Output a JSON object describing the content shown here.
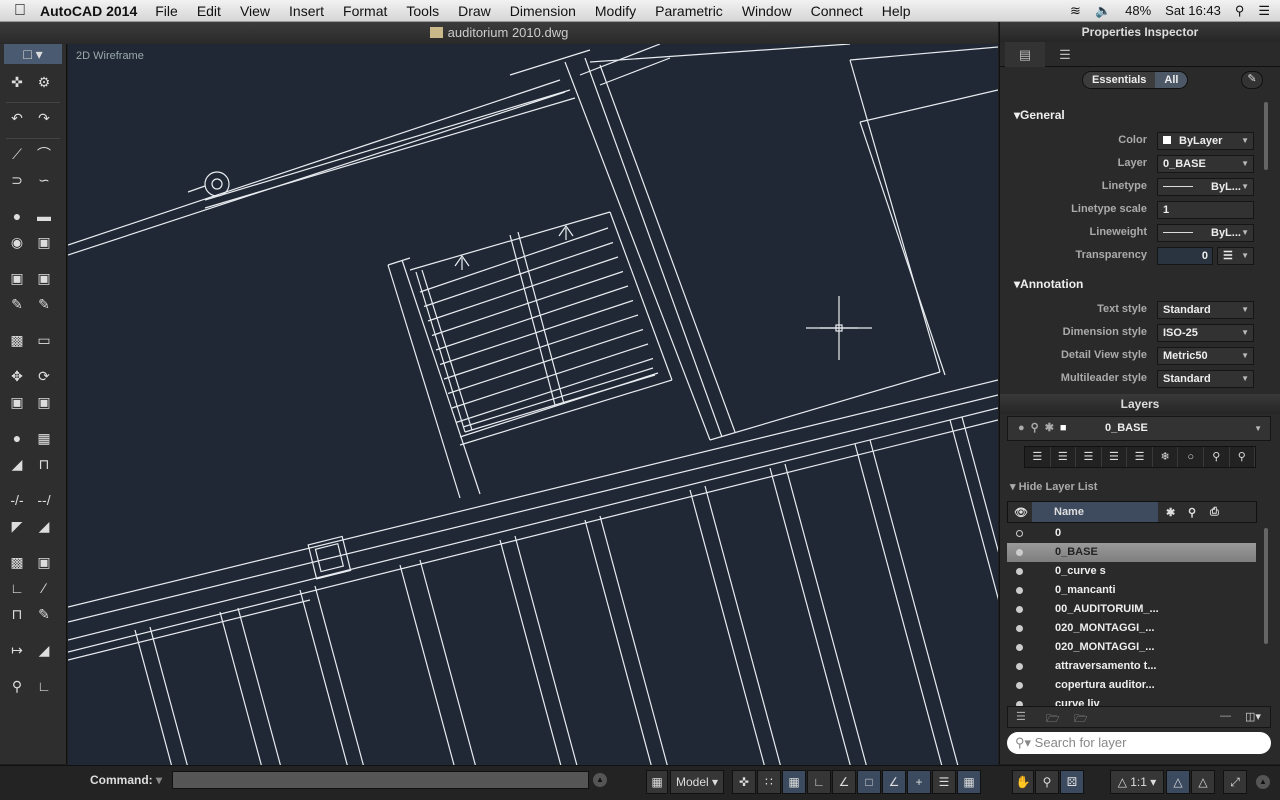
{
  "menubar": {
    "app": "AutoCAD 2014",
    "items": [
      "File",
      "Edit",
      "View",
      "Insert",
      "Format",
      "Tools",
      "Draw",
      "Dimension",
      "Modify",
      "Parametric",
      "Window",
      "Connect",
      "Help"
    ],
    "battery": "48%",
    "clock": "Sat 16:43"
  },
  "window": {
    "title": "auditorium 2010.dwg"
  },
  "canvas": {
    "visual_style": "2D Wireframe",
    "background": "#212835"
  },
  "properties": {
    "title": "Properties Inspector",
    "segments": [
      "Essentials",
      "All"
    ],
    "active_segment": "All",
    "general_label": "General",
    "general": [
      {
        "label": "Color",
        "value": "ByLayer"
      },
      {
        "label": "Layer",
        "value": "0_BASE"
      },
      {
        "label": "Linetype",
        "value": "ByL..."
      },
      {
        "label": "Linetype scale",
        "value": "1"
      },
      {
        "label": "Lineweight",
        "value": "ByL..."
      },
      {
        "label": "Transparency",
        "value": "0"
      }
    ],
    "annotation_label": "Annotation",
    "annotation": [
      {
        "label": "Text style",
        "value": "Standard"
      },
      {
        "label": "Dimension style",
        "value": "ISO-25"
      },
      {
        "label": "Detail View style",
        "value": "Metric50"
      },
      {
        "label": "Multileader style",
        "value": "Standard"
      }
    ]
  },
  "layers": {
    "title": "Layers",
    "current": "0_BASE",
    "hide_label": "Hide Layer List",
    "column_name": "Name",
    "items": [
      "0",
      "0_BASE",
      "0_curve s",
      "0_mancanti",
      "00_AUDITORUIM_...",
      "020_MONTAGGI_...",
      "020_MONTAGGI_...",
      "attraversamento t...",
      "copertura auditor...",
      "curve liv"
    ],
    "selected": "0_BASE",
    "search_placeholder": "Search for layer"
  },
  "status": {
    "command_label": "Command:",
    "model": "Model",
    "scale": "1:1"
  }
}
